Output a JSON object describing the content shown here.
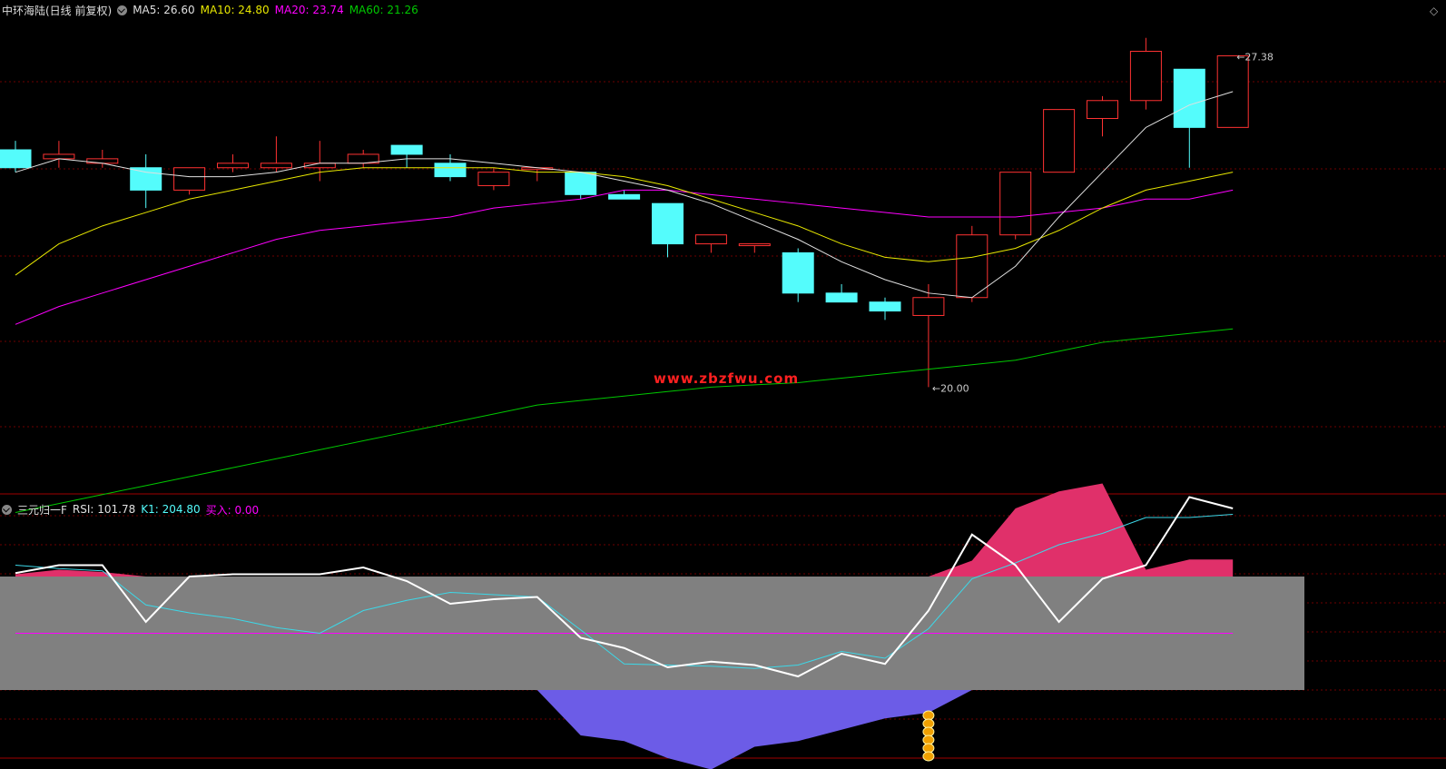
{
  "price_header": {
    "title": "中环海陆(日线 前复权)",
    "ma5": "MA5: 26.60",
    "ma10": "MA10: 24.80",
    "ma20": "MA20: 23.74",
    "ma60": "MA60: 21.26"
  },
  "indicator_header": {
    "name": "三元归一F",
    "rsi": "RSI: 101.78",
    "k1": "K1: 204.80",
    "buy": "买入: 0.00"
  },
  "watermark": "www.zbzfwu.com",
  "colors": {
    "up": "#ff3232",
    "down": "#54fcfc",
    "ma5": "#e0e0e0",
    "ma10": "#e8e800",
    "ma20": "#ff00ff",
    "ma60": "#00c800",
    "grid": "#6e0000",
    "band": "#808080",
    "pink": "#e0306a",
    "purple": "#6c5ce7",
    "coin": "#f0a000"
  },
  "chart_data": [
    {
      "type": "candlestick",
      "ylim": [
        18.0,
        28.2
      ],
      "candles": [
        {
          "o": 25.3,
          "h": 25.5,
          "l": 24.8,
          "c": 24.9
        },
        {
          "o": 25.1,
          "h": 25.5,
          "l": 24.9,
          "c": 25.2
        },
        {
          "o": 25.0,
          "h": 25.3,
          "l": 24.9,
          "c": 25.1
        },
        {
          "o": 24.9,
          "h": 25.2,
          "l": 24.0,
          "c": 24.4
        },
        {
          "o": 24.4,
          "h": 24.9,
          "l": 24.3,
          "c": 24.9
        },
        {
          "o": 24.9,
          "h": 25.2,
          "l": 24.8,
          "c": 25.0
        },
        {
          "o": 24.9,
          "h": 25.6,
          "l": 24.8,
          "c": 25.0
        },
        {
          "o": 24.9,
          "h": 25.5,
          "l": 24.6,
          "c": 25.0
        },
        {
          "o": 25.0,
          "h": 25.3,
          "l": 24.9,
          "c": 25.2
        },
        {
          "o": 25.4,
          "h": 25.4,
          "l": 24.9,
          "c": 25.2
        },
        {
          "o": 25.0,
          "h": 25.2,
          "l": 24.6,
          "c": 24.7
        },
        {
          "o": 24.5,
          "h": 24.9,
          "l": 24.4,
          "c": 24.8
        },
        {
          "o": 24.9,
          "h": 24.9,
          "l": 24.6,
          "c": 24.9
        },
        {
          "o": 24.8,
          "h": 24.8,
          "l": 24.2,
          "c": 24.3
        },
        {
          "o": 24.3,
          "h": 24.4,
          "l": 24.2,
          "c": 24.2
        },
        {
          "o": 24.1,
          "h": 24.1,
          "l": 22.9,
          "c": 23.2
        },
        {
          "o": 23.2,
          "h": 23.4,
          "l": 23.0,
          "c": 23.4
        },
        {
          "o": 23.2,
          "h": 23.2,
          "l": 23.0,
          "c": 23.2
        },
        {
          "o": 23.0,
          "h": 23.1,
          "l": 21.9,
          "c": 22.1
        },
        {
          "o": 22.1,
          "h": 22.3,
          "l": 21.9,
          "c": 21.9
        },
        {
          "o": 21.9,
          "h": 22.0,
          "l": 21.5,
          "c": 21.7
        },
        {
          "o": 21.6,
          "h": 22.3,
          "l": 20.0,
          "c": 22.0
        },
        {
          "o": 22.0,
          "h": 23.6,
          "l": 21.9,
          "c": 23.4
        },
        {
          "o": 23.4,
          "h": 24.4,
          "l": 23.3,
          "c": 24.8
        },
        {
          "o": 24.8,
          "h": 26.2,
          "l": 24.8,
          "c": 26.2
        },
        {
          "o": 26.0,
          "h": 26.5,
          "l": 25.6,
          "c": 26.4
        },
        {
          "o": 26.4,
          "h": 27.8,
          "l": 26.2,
          "c": 27.5
        },
        {
          "o": 27.1,
          "h": 27.1,
          "l": 24.9,
          "c": 25.8
        },
        {
          "o": 25.8,
          "h": 27.4,
          "l": 25.8,
          "c": 27.4
        }
      ],
      "ma5": [
        24.8,
        25.1,
        25.0,
        24.8,
        24.7,
        24.7,
        24.8,
        25.0,
        25.0,
        25.1,
        25.1,
        25.0,
        24.9,
        24.8,
        24.6,
        24.4,
        24.1,
        23.7,
        23.3,
        22.8,
        22.4,
        22.1,
        22.0,
        22.7,
        23.8,
        24.8,
        25.8,
        26.3,
        26.6
      ],
      "ma10": [
        22.5,
        23.2,
        23.6,
        23.9,
        24.2,
        24.4,
        24.6,
        24.8,
        24.9,
        24.9,
        24.9,
        24.9,
        24.8,
        24.8,
        24.7,
        24.5,
        24.2,
        23.9,
        23.6,
        23.2,
        22.9,
        22.8,
        22.9,
        23.1,
        23.5,
        24.0,
        24.4,
        24.6,
        24.8
      ],
      "ma20": [
        21.4,
        21.8,
        22.1,
        22.4,
        22.7,
        23.0,
        23.3,
        23.5,
        23.6,
        23.7,
        23.8,
        24.0,
        24.1,
        24.2,
        24.4,
        24.4,
        24.3,
        24.2,
        24.1,
        24.0,
        23.9,
        23.8,
        23.8,
        23.8,
        23.9,
        24.0,
        24.2,
        24.2,
        24.4
      ],
      "ma60": [
        17.2,
        17.4,
        17.6,
        17.8,
        18.0,
        18.2,
        18.4,
        18.6,
        18.8,
        19.0,
        19.2,
        19.4,
        19.6,
        19.7,
        19.8,
        19.9,
        20.0,
        20.05,
        20.1,
        20.2,
        20.3,
        20.4,
        20.5,
        20.6,
        20.8,
        21.0,
        21.1,
        21.2,
        21.3
      ],
      "annotations": [
        {
          "index": 21,
          "label": "20.00"
        },
        {
          "index": 28,
          "label": "27.38"
        }
      ]
    },
    {
      "type": "line",
      "ylim": [
        -10,
        210
      ],
      "band": [
        50,
        150
      ],
      "midline": 100,
      "white": [
        153,
        160,
        160,
        110,
        150,
        152,
        152,
        152,
        158,
        146,
        126,
        130,
        132,
        96,
        87,
        70,
        75,
        72,
        62,
        82,
        73,
        120,
        187,
        160,
        110,
        148,
        160,
        220,
        210
      ],
      "cyan": [
        160,
        157,
        155,
        125,
        118,
        113,
        105,
        100,
        120,
        129,
        136,
        134,
        132,
        103,
        73,
        72,
        71,
        69,
        72,
        84,
        78,
        104,
        148,
        162,
        178,
        188,
        202,
        202,
        204.8
      ],
      "pink_area": [
        2,
        6,
        4,
        0,
        0,
        0,
        0,
        0,
        0,
        0,
        0,
        0,
        0,
        0,
        0,
        0,
        0,
        0,
        0,
        0,
        0,
        0,
        14,
        60,
        75,
        82,
        6,
        15,
        15
      ],
      "purple_area": [
        0,
        0,
        0,
        0,
        0,
        0,
        0,
        0,
        0,
        0,
        0,
        0,
        0,
        -40,
        -45,
        -60,
        -70,
        -50,
        -45,
        -35,
        -25,
        -20,
        0,
        0,
        0,
        0,
        0,
        0,
        0
      ],
      "buy_index": 21
    }
  ]
}
